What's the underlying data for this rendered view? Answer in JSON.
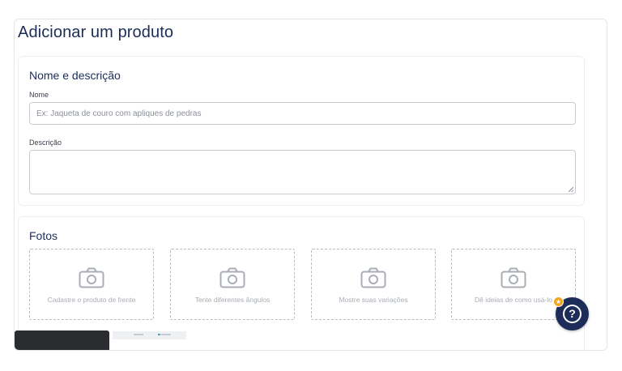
{
  "page": {
    "title": "Adicionar um produto"
  },
  "desc_section": {
    "title": "Nome e descrição",
    "name_label": "Nome",
    "name_placeholder": "Ex: Jaqueta de couro com apliques de pedras",
    "description_label": "Descrição"
  },
  "photos_section": {
    "title": "Fotos",
    "slots": [
      {
        "caption": "Cadastre o produto de frente",
        "icon": "camera-icon"
      },
      {
        "caption": "Tente diferentes ângulos",
        "icon": "camera-icon"
      },
      {
        "caption": "Mostre suas variações",
        "icon": "camera-icon"
      },
      {
        "caption": "Dê ideias de como usá-lo",
        "icon": "camera-icon"
      }
    ]
  },
  "help": {
    "icon": "question-icon",
    "badge_icon": "star-icon"
  },
  "colors": {
    "primary": "#1c2d5a",
    "badge": "#f2a623",
    "border": "#c9ccd3"
  }
}
